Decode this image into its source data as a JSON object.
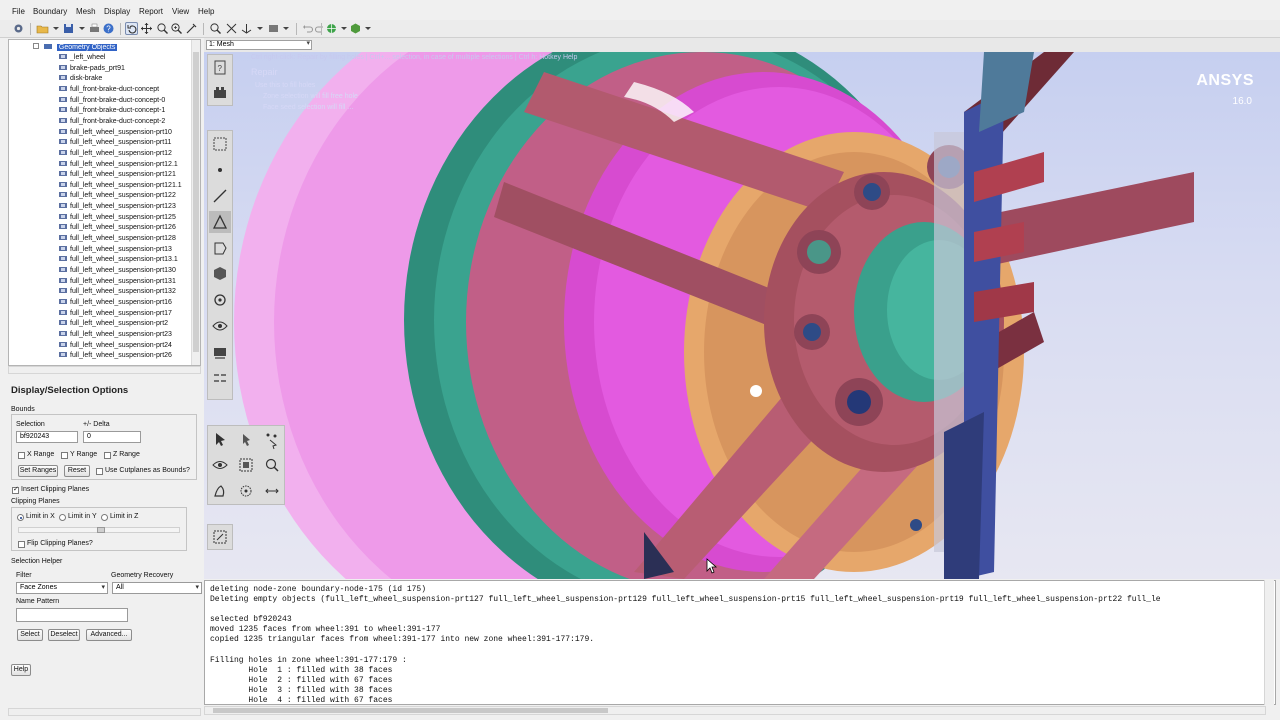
{
  "menu": [
    "File",
    "Boundary",
    "Mesh",
    "Display",
    "Report",
    "View",
    "Help"
  ],
  "tree": {
    "root": "Geometry Objects",
    "items": [
      "_left_wheel",
      "brake-pads_prt91",
      "disk-brake",
      "full_front-brake-duct-concept",
      "full_front-brake-duct-concept-0",
      "full_front-brake-duct-concept-1",
      "full_front-brake-duct-concept-2",
      "full_left_wheel_suspension-prt10",
      "full_left_wheel_suspension-prt11",
      "full_left_wheel_suspension-prt12",
      "full_left_wheel_suspension-prt12.1",
      "full_left_wheel_suspension-prt121",
      "full_left_wheel_suspension-prt121.1",
      "full_left_wheel_suspension-prt122",
      "full_left_wheel_suspension-prt123",
      "full_left_wheel_suspension-prt125",
      "full_left_wheel_suspension-prt126",
      "full_left_wheel_suspension-prt128",
      "full_left_wheel_suspension-prt13",
      "full_left_wheel_suspension-prt13.1",
      "full_left_wheel_suspension-prt130",
      "full_left_wheel_suspension-prt131",
      "full_left_wheel_suspension-prt132",
      "full_left_wheel_suspension-prt16",
      "full_left_wheel_suspension-prt17",
      "full_left_wheel_suspension-prt2",
      "full_left_wheel_suspension-prt23",
      "full_left_wheel_suspension-prt24",
      "full_left_wheel_suspension-prt26"
    ]
  },
  "options": {
    "title": "Display/Selection Options",
    "bounds_label": "Bounds",
    "selection_label": "Selection",
    "selection_value": "bf920243",
    "delta_label": "+/- Delta",
    "delta_value": "0",
    "x_range": "X Range",
    "y_range": "Y Range",
    "z_range": "Z Range",
    "set_ranges": "Set Ranges",
    "reset": "Reset",
    "use_cutplanes": "Use Cutplanes as Bounds?",
    "insert_clipping": "Insert Clipping Planes",
    "clipping_planes": "Clipping Planes",
    "limit_x": "Limit in X",
    "limit_y": "Limit in Y",
    "limit_z": "Limit in Z",
    "flip_clipping": "Flip Clipping Planes?",
    "selection_helper": "Selection Helper",
    "filter_label": "Filter",
    "filter_value": "Face Zones",
    "geometry_recovery_label": "Geometry Recovery",
    "geometry_recovery_value": "All",
    "name_pattern_label": "Name Pattern",
    "name_pattern_value": "",
    "select": "Select",
    "deselect": "Deselect",
    "advanced": "Advanced...",
    "help": "Help"
  },
  "viewport": {
    "combo": "1: Mesh",
    "hint": "Ctrl right-click: Repair by filling holes | Ctrl+... selection, in case of multiple selections | Ctrl h: Hotkey Help",
    "mode": "Repair",
    "help1": "Use this to fill holes",
    "help2": "Zone selection will fill free hole",
    "help3": "Face seed selection will fill ...",
    "brand": "ANSYS",
    "version": "16.0"
  },
  "console": {
    "lines": [
      "deleting node-zone boundary-node-175 (id 175)",
      "Deleting empty objects (full_left_wheel_suspension-prt127 full_left_wheel_suspension-prt129 full_left_wheel_suspension-prt15 full_left_wheel_suspension-prt19 full_left_wheel_suspension-prt22 full_le",
      "",
      "selected bf920243",
      "moved 1235 faces from wheel:391 to wheel:391-177",
      "copied 1235 triangular faces from wheel:391-177 into new zone wheel:391-177:179.",
      "",
      "Filling holes in zone wheel:391-177:179 :",
      "        Hole  1 : filled with 38 faces",
      "        Hole  2 : filled with 67 faces",
      "        Hole  3 : filled with 38 faces",
      "        Hole  4 : filled with 67 faces"
    ]
  },
  "colors": {
    "wheel_rim": "#2e8b7a",
    "wheel_face": "#c05a8a",
    "disc": "#e24fd6",
    "hub": "#a25060",
    "caliper": "#e0a06a",
    "background_top": "#c6cff0"
  }
}
